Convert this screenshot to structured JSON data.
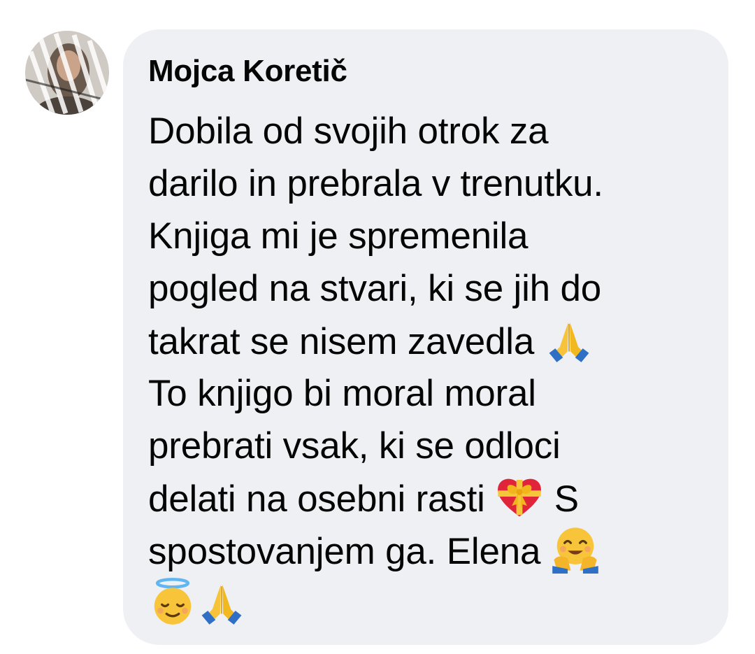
{
  "comment": {
    "author": "Mojca Koretič",
    "lines": [
      [
        {
          "t": "Dobila od svojih otrok za"
        }
      ],
      [
        {
          "t": "darilo in prebrala v trenutku."
        }
      ],
      [
        {
          "t": "Knjiga mi je spremenila"
        }
      ],
      [
        {
          "t": "pogled na stvari, ki se jih do"
        }
      ],
      [
        {
          "t": "takrat se nisem zavedla "
        },
        {
          "emoji": "folded-hands-icon"
        }
      ],
      [
        {
          "t": "To knjigo bi moral moral"
        }
      ],
      [
        {
          "t": "prebrati vsak, ki se odloci"
        }
      ],
      [
        {
          "t": "delati na osebni rasti "
        },
        {
          "emoji": "heart-with-ribbon-icon"
        },
        {
          "t": " S"
        }
      ],
      [
        {
          "t": "spostovanjem ga. Elena "
        },
        {
          "emoji": "hugging-face-icon"
        }
      ],
      [
        {
          "emoji": "smiling-face-with-halo-icon"
        },
        {
          "emoji": "folded-hands-icon"
        }
      ]
    ]
  },
  "colors": {
    "bubble_background": "#eff0f4",
    "text": "#050505",
    "page_background": "#ffffff"
  }
}
